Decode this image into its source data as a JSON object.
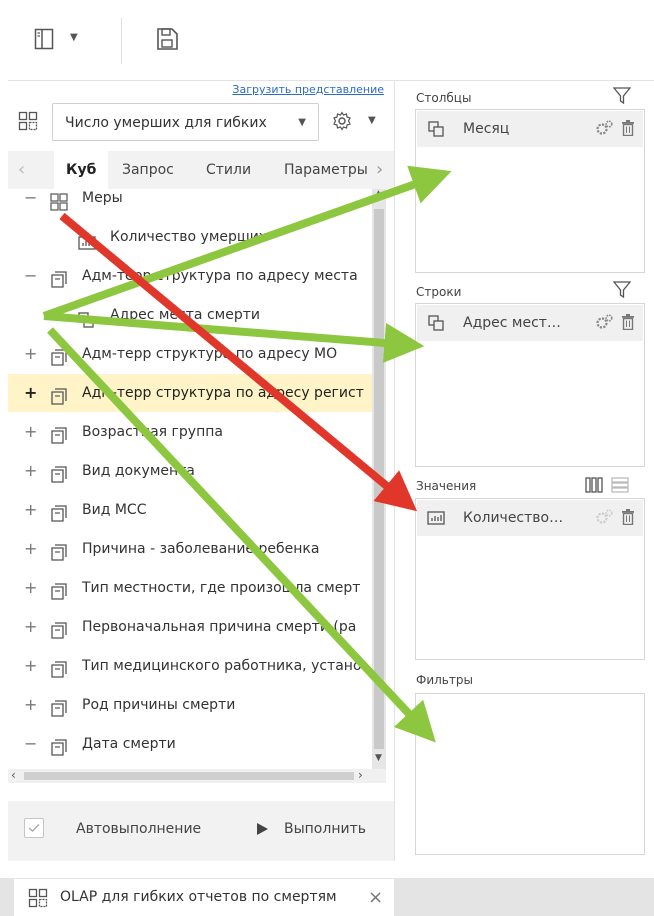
{
  "left": {
    "load_view_link": "Загрузить представление",
    "measure_select_value": "Число умерших для гибких",
    "tabs": [
      "Куб",
      "Запрос",
      "Стили",
      "Параметры"
    ],
    "tree": [
      {
        "toggle": "−",
        "label": "Меры",
        "icon": "measures-group-icon"
      },
      {
        "toggle": "",
        "label": "Количество умерших",
        "icon": "measure-icon"
      },
      {
        "toggle": "−",
        "label": "Адм-терр структура по адресу места",
        "icon": "dimension-icon"
      },
      {
        "toggle": "+",
        "label": "Адрес места смерти",
        "icon": "hierarchy-icon"
      },
      {
        "toggle": "+",
        "label": "Адм-терр структура по адресу МО",
        "icon": "dimension-icon"
      },
      {
        "toggle": "+",
        "label": "Адм-терр структура по адресу регист",
        "icon": "dimension-icon"
      },
      {
        "toggle": "+",
        "label": "Возрастная группа",
        "icon": "dimension-icon"
      },
      {
        "toggle": "+",
        "label": "Вид документа",
        "icon": "dimension-icon"
      },
      {
        "toggle": "+",
        "label": "Вид МСС",
        "icon": "dimension-icon"
      },
      {
        "toggle": "+",
        "label": "Причина - заболевание ребенка",
        "icon": "dimension-icon"
      },
      {
        "toggle": "+",
        "label": "Тип местности, где произошла смерт",
        "icon": "dimension-icon"
      },
      {
        "toggle": "+",
        "label": "Первоначальная причина смерти (ра",
        "icon": "dimension-icon"
      },
      {
        "toggle": "+",
        "label": "Тип медицинского работника, устано",
        "icon": "dimension-icon"
      },
      {
        "toggle": "+",
        "label": "Род причины смерти",
        "icon": "dimension-icon"
      },
      {
        "toggle": "−",
        "label": "Дата смерти",
        "icon": "dimension-icon"
      }
    ],
    "highlighted_index": 5,
    "autorun_label": "Автовыполнение",
    "run_label": "Выполнить"
  },
  "right": {
    "columns_title": "Столбцы",
    "columns_chip": "Месяц",
    "rows_title": "Строки",
    "rows_chip": "Адрес мест…",
    "values_title": "Значения",
    "values_chip": "Количество…",
    "filters_title": "Фильтры"
  },
  "bottom_tab": {
    "label": "OLAP для гибких отчетов по смертям",
    "close": "×"
  },
  "colors": {
    "highlight_row": "#fff3c8",
    "arrow_green": "#8dc63f",
    "arrow_red": "#e0372a",
    "link": "#2b6cc4"
  }
}
